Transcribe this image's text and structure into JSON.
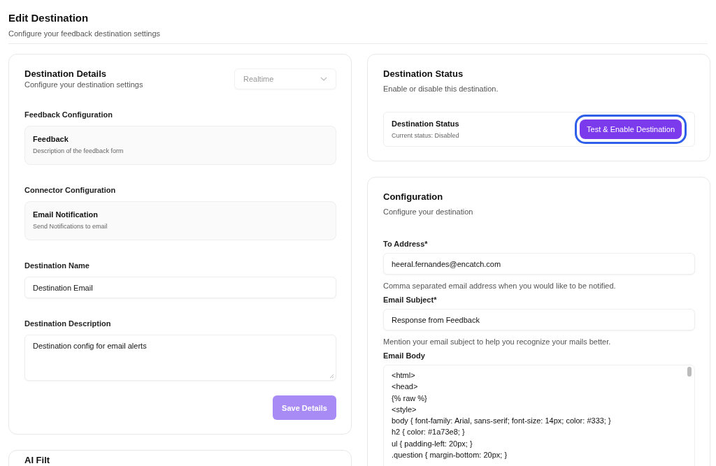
{
  "page": {
    "title": "Edit Destination",
    "subtitle": "Configure your feedback destination settings"
  },
  "details": {
    "title": "Destination Details",
    "subtitle": "Configure your destination settings",
    "mode": {
      "value": "Realtime",
      "disabled": true
    },
    "sections": [
      {
        "kind": "option",
        "label": "Feedback Configuration",
        "title": "Feedback",
        "description": "Description of the feedback form"
      },
      {
        "kind": "option",
        "label": "Connector Configuration",
        "title": "Email Notification",
        "description": "Send Notifications to email"
      },
      {
        "kind": "input",
        "label": "Destination Name",
        "value": "Destination Email"
      },
      {
        "kind": "textarea",
        "label": "Destination Description",
        "value": "Destination config for email alerts"
      }
    ],
    "save": {
      "label": "Save Details",
      "disabled": true
    }
  },
  "next_card": {
    "title": "AI Filt"
  },
  "status": {
    "title": "Destination Status",
    "subtitle": "Enable or disable this destination.",
    "row_title": "Destination Status",
    "row_status": "Current status: Disabled",
    "button": {
      "label": "Test & Enable Destination",
      "focused": true
    }
  },
  "configuration": {
    "title": "Configuration",
    "subtitle": "Configure your destination",
    "fields": [
      {
        "kind": "input",
        "label": "To Address*",
        "value": "heeral.fernandes@encatch.com",
        "help": "Comma separated email address when you would like to be notified."
      },
      {
        "kind": "input",
        "label": "Email Subject*",
        "value": "Response from Feedback",
        "help": "Mention your email subject to help you recognize your mails better."
      },
      {
        "kind": "code",
        "label": "Email Body",
        "value": "<html>\n<head>\n{% raw %}\n<style>\nbody { font-family: Arial, sans-serif; font-size: 14px; color: #333; }\nh2 { color: #1a73e8; }\nul { padding-left: 20px; }\n.question { margin-bottom: 20px; }"
      }
    ]
  }
}
